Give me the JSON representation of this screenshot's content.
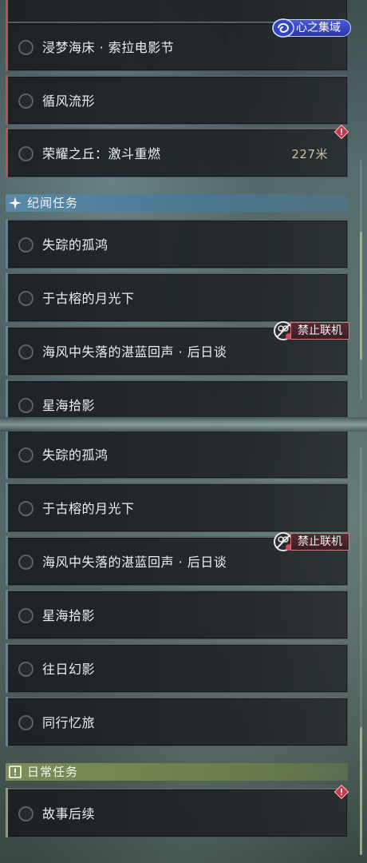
{
  "realm_badge": {
    "label": "心之集域",
    "icon": "swirl-icon"
  },
  "top_panel": {
    "main_quests": [
      {
        "title": "浸梦海床 · 索拉电影节",
        "accent": "#b5584a"
      },
      {
        "title": "循风流形",
        "accent": "#b5584a"
      },
      {
        "title": "荣耀之丘：激斗重燃",
        "distance": "227米",
        "warning": true,
        "accent": "#b5584a"
      }
    ],
    "story_section": {
      "label": "纪闻任务",
      "icon": "sparkle-icon"
    },
    "story_quests": [
      {
        "title": "失踪的孤鸿"
      },
      {
        "title": "于古榕的月光下"
      },
      {
        "title": "海风中失落的湛蓝回声 · 后日谈",
        "badge": "禁止联机"
      },
      {
        "title": "星海拾影"
      }
    ]
  },
  "bottom_panel": {
    "story_quests": [
      {
        "title": "失踪的孤鸿"
      },
      {
        "title": "于古榕的月光下"
      },
      {
        "title": "海风中失落的湛蓝回声 · 后日谈",
        "badge": "禁止联机"
      },
      {
        "title": "星海拾影"
      },
      {
        "title": "往日幻影"
      },
      {
        "title": "同行忆旅"
      }
    ],
    "daily_section": {
      "label": "日常任务",
      "icon": "exclamation-box-icon"
    },
    "daily_quests": [
      {
        "title": "故事后续",
        "warning": true
      }
    ]
  },
  "colors": {
    "main_accent": "#b5584a",
    "story_accent": "#5d83a0",
    "daily_accent": "#8d9e6a",
    "coop_badge_border": "#d47a80",
    "realm_badge_bg": "#3a46c0"
  }
}
